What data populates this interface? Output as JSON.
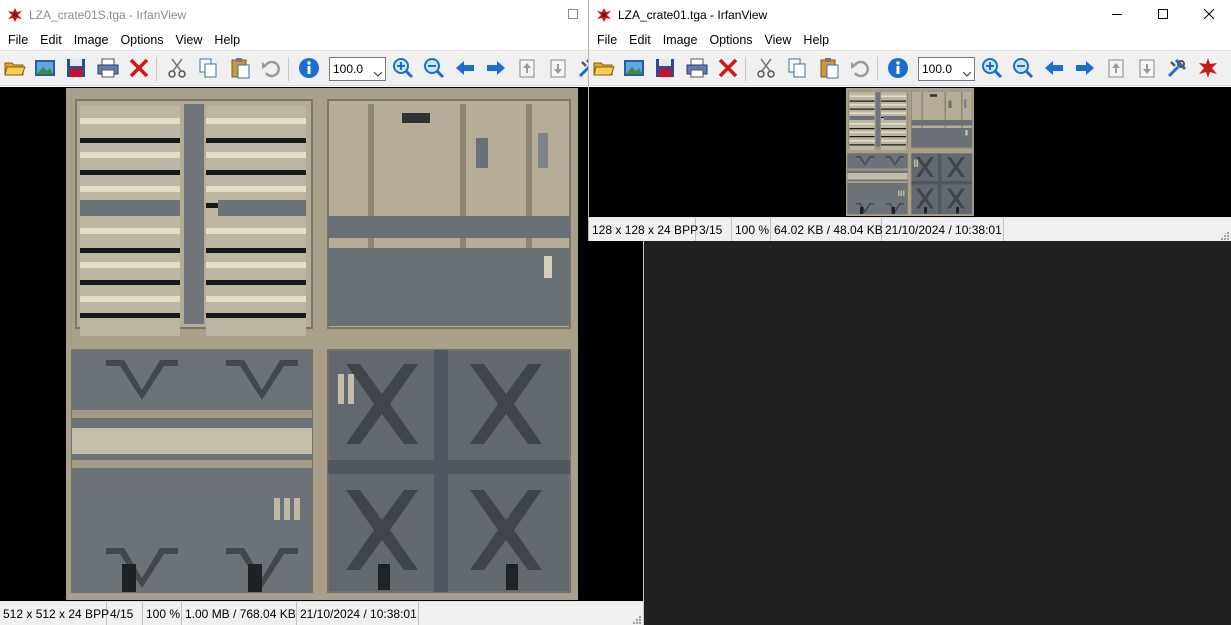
{
  "icons": [
    "irfanview-app-icon",
    "open-folder-icon",
    "slideshow-icon",
    "save-icon",
    "print-icon",
    "delete-icon",
    "cut-icon",
    "copy-icon",
    "paste-icon",
    "undo-icon",
    "info-icon",
    "zoom-in-icon",
    "zoom-out-icon",
    "previous-icon",
    "next-icon",
    "page-up-icon",
    "page-down-icon",
    "settings-icon",
    "exit-icon",
    "minimize-icon",
    "maximize-icon",
    "close-icon"
  ],
  "colors": {
    "desktop": "#202020",
    "image_background": "#000000",
    "toolbar": "#f0f0f0",
    "statusbar": "#f0f0f0",
    "accent_blue": "#1b6ed1"
  },
  "window_left": {
    "title": "LZA_crate01S.tga - IrfanView",
    "menu": [
      "File",
      "Edit",
      "Image",
      "Options",
      "View",
      "Help"
    ],
    "zoom": "100.0",
    "status": {
      "dimensions": "512 x 512 x 24 BPP",
      "index": "4/15",
      "zoom": "100 %",
      "size": "1.00 MB / 768.04 KB",
      "datetime": "21/10/2024 / 10:38:01"
    }
  },
  "window_right": {
    "title": "LZA_crate01.tga - IrfanView",
    "menu": [
      "File",
      "Edit",
      "Image",
      "Options",
      "View",
      "Help"
    ],
    "zoom": "100.0",
    "status": {
      "dimensions": "128 x 128 x 24 BPP",
      "index": "3/15",
      "zoom": "100 %",
      "size": "64.02 KB / 48.04 KB",
      "datetime": "21/10/2024 / 10:38:01"
    }
  }
}
